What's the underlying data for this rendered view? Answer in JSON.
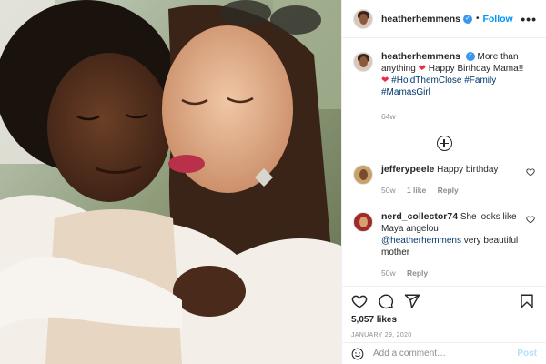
{
  "header": {
    "username": "heatherhemmens",
    "separator": "•",
    "follow_label": "Follow",
    "more_label": "•••"
  },
  "caption": {
    "username": "heatherhemmens",
    "text_1": "More than anything",
    "text_2": "Happy Birthday Mama!!",
    "hashtags": [
      "#HoldThemClose",
      "#Family",
      "#MamasGirl"
    ],
    "age": "64w"
  },
  "comments": [
    {
      "username": "jefferypeele",
      "text": "Happy birthday",
      "age": "50w",
      "likes": "1 like",
      "reply_label": "Reply"
    },
    {
      "username": "nerd_collector74",
      "text": "She looks like Maya angelou",
      "mention": "@heatherhemmens",
      "text_after": "very beautiful mother",
      "age": "50w",
      "reply_label": "Reply"
    }
  ],
  "post": {
    "likes": "5,057 likes",
    "date": "JANUARY 29, 2020"
  },
  "add_comment": {
    "placeholder": "Add a comment…",
    "post_label": "Post"
  },
  "colors": {
    "link_blue": "#0095f6",
    "hashtag_blue": "#00376b",
    "verified_blue": "#3897f0",
    "muted_gray": "#8e8e8e",
    "heart_red": "#ed2a4a"
  },
  "icons": [
    "verified-badge-icon",
    "heart-emoji-icon",
    "load-more-icon",
    "heart-icon",
    "comment-icon",
    "share-icon",
    "bookmark-icon",
    "emoji-icon"
  ]
}
